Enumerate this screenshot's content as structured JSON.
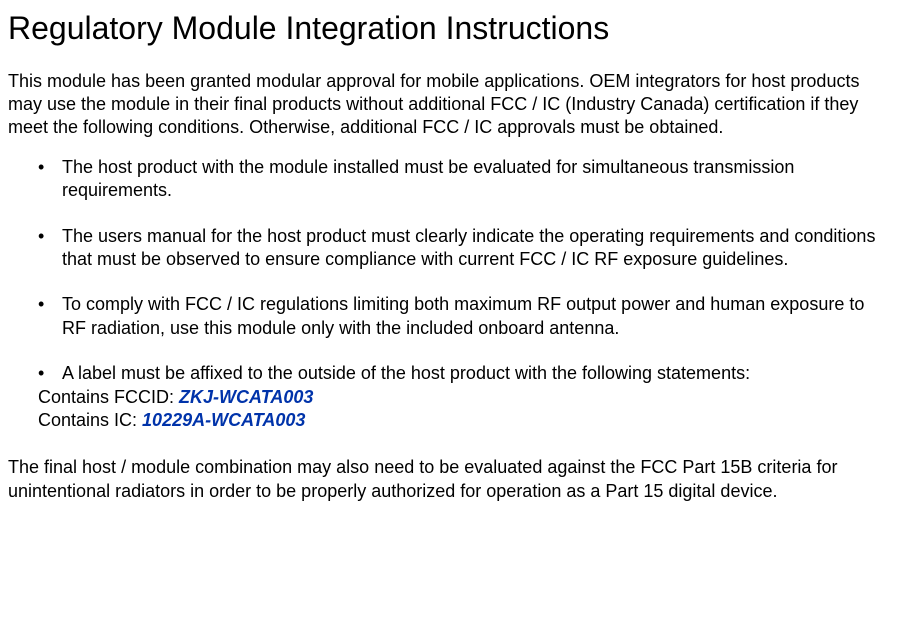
{
  "title": "Regulatory Module Integration Instructions",
  "intro": "This module has been granted modular approval for mobile applications. OEM integrators for host products may use the module in their final products without additional FCC / IC (Industry Canada) certification if they meet the following conditions. Otherwise, additional FCC / IC approvals must be obtained.",
  "bullets": [
    "The host product with the module installed must be evaluated for simultaneous transmission requirements.",
    "The users manual for the host product must clearly indicate the operating requirements and conditions that must be observed to ensure compliance with current FCC / IC RF exposure guidelines.",
    "To comply with FCC / IC regulations limiting both maximum RF output power and human exposure to RF radiation, use this module only with the included onboard antenna.",
    "A label must be affixed to the outside of the host product with the following statements:"
  ],
  "labels": {
    "fccid_prefix": "Contains FCCID: ",
    "fccid_value": "ZKJ-WCATA003",
    "ic_prefix": "Contains IC: ",
    "ic_value": "10229A-WCATA003"
  },
  "final": "The final host / module combination may also need to be evaluated against the FCC Part 15B criteria for unintentional radiators in order to be properly authorized for operation as a Part 15 digital device."
}
